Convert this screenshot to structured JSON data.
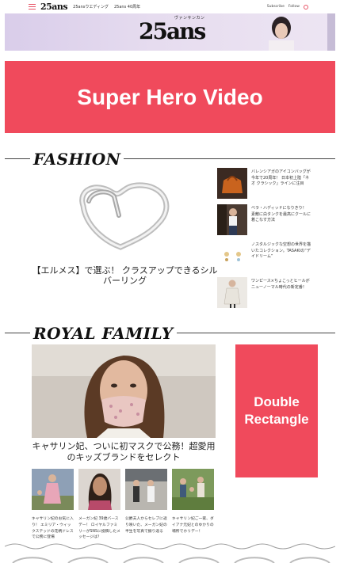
{
  "header": {
    "logo": "25ans",
    "nav": [
      "25ansウエディング",
      "25ans 40周年"
    ],
    "subscribe": "Subscribe",
    "follow": "Follow"
  },
  "banner": {
    "logo": "25ans",
    "sub": "ヴァンサンカン"
  },
  "superhero": {
    "label": "Super Hero Video"
  },
  "fashion": {
    "heading": "FASHION",
    "main_caption": "【エルメス】で選ぶ！ クラスアップできるシルバーリング",
    "side_items": [
      {
        "text": "バレンシアガのアイコンバッグが今年で20周年！ 日本初上陸「ネオ クラシック」ラインに注目"
      },
      {
        "text": "ベラ・ハディッドになりきり！　素敵に白タンクを最高にクールに着こなす方法"
      },
      {
        "text": "ノスタルジックな空想の世界を描いたコレクション。TASAKIの“デイドリーム”"
      },
      {
        "text": "ワンピース×ちょこっとヒールがニューノーマル時代の新定番！"
      }
    ]
  },
  "royal": {
    "heading": "ROYAL FAMILY",
    "main_caption": "キャサリン妃、ついに初マスクで公務！超愛用のキッズブランドをセレクト",
    "ad_label_line1": "Double",
    "ad_label_line2": "Rectangle",
    "thumbs": [
      {
        "text": "キャサリン妃のお気に入り！ エミリア・ウィックステッドの花柄ドレスで公務に登場"
      },
      {
        "text": "メーガン妃 39歳バースデー！ ロイヤルファミリーがSNSに投稿したメッセージは？"
      },
      {
        "text": "公爵夫人からセレブに返り咲いた、メーガン妃の半生を写真で振り返る"
      },
      {
        "text": "キャサリン妃ご一家、ダイアナ元妃とのゆかりの場所でホリデー！"
      }
    ]
  },
  "colors": {
    "accent": "#f04a5c",
    "banner_bg": "#e3d9ee"
  }
}
